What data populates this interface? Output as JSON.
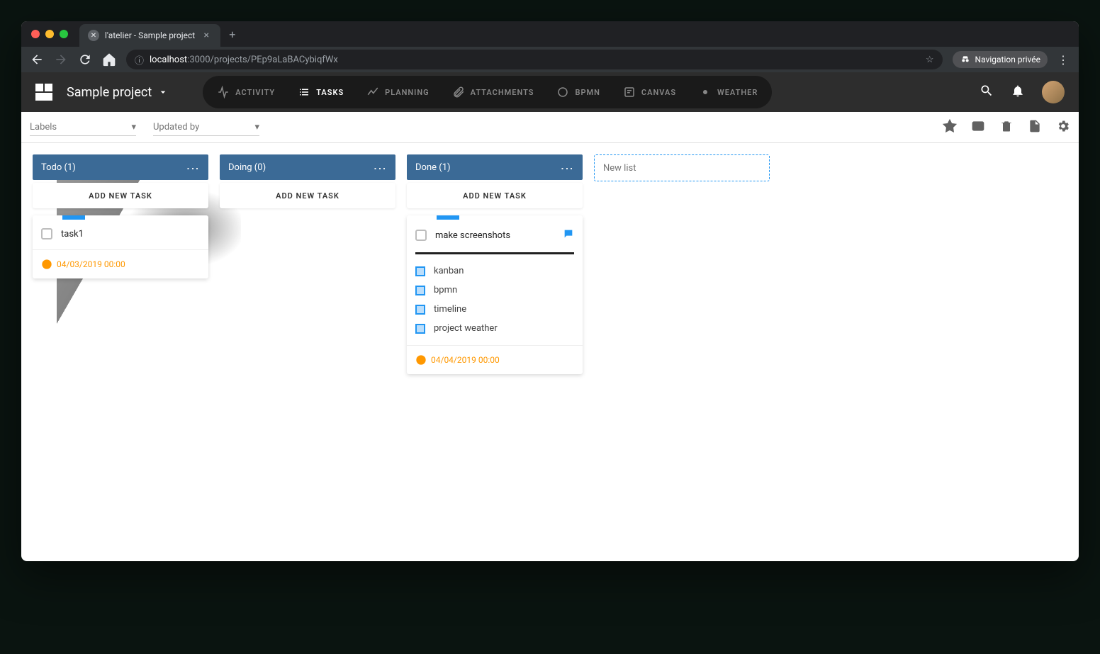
{
  "browser": {
    "tab_title": "l'atelier - Sample project",
    "url_host": "localhost",
    "url_port_path": ":3000/projects/PEp9aLaBACybiqfWx",
    "incognito_label": "Navigation privée"
  },
  "header": {
    "project_title": "Sample project",
    "nav": [
      {
        "label": "ACTIVITY"
      },
      {
        "label": "TASKS"
      },
      {
        "label": "PLANNING"
      },
      {
        "label": "ATTACHMENTS"
      },
      {
        "label": "BPMN"
      },
      {
        "label": "CANVAS"
      },
      {
        "label": "WEATHER"
      }
    ]
  },
  "filters": {
    "labels": "Labels",
    "updated_by": "Updated by"
  },
  "board": {
    "add_task_label": "ADD NEW TASK",
    "new_list_placeholder": "New list",
    "lists": [
      {
        "title": "Todo (1)",
        "cards": [
          {
            "title": "task1",
            "due": "04/03/2019 00:00"
          }
        ]
      },
      {
        "title": "Doing (0)",
        "cards": []
      },
      {
        "title": "Done (1)",
        "cards": [
          {
            "title": "make screenshots",
            "has_comments": true,
            "subtasks": [
              "kanban",
              "bpmn",
              "timeline",
              "project weather"
            ],
            "due": "04/04/2019 00:00"
          }
        ]
      }
    ]
  }
}
